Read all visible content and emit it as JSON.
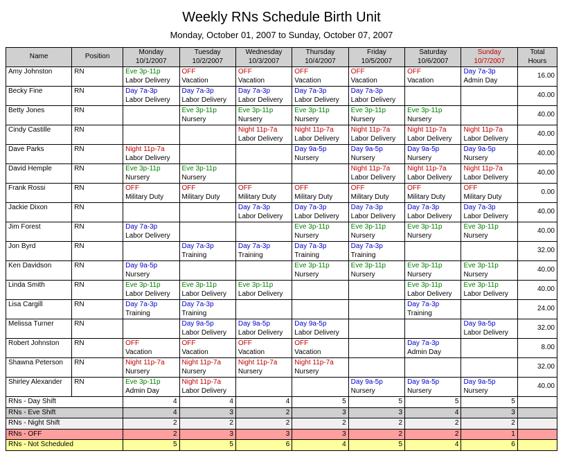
{
  "title": "Weekly RNs Schedule Birth Unit",
  "subtitle": "Monday, October 01, 2007 to Sunday, October 07, 2007",
  "headers": {
    "name": "Name",
    "position": "Position",
    "days": [
      {
        "label": "Monday",
        "date": "10/1/2007"
      },
      {
        "label": "Tuesday",
        "date": "10/2/2007"
      },
      {
        "label": "Wednesday",
        "date": "10/3/2007"
      },
      {
        "label": "Thursday",
        "date": "10/4/2007"
      },
      {
        "label": "Friday",
        "date": "10/5/2007"
      },
      {
        "label": "Saturday",
        "date": "10/6/2007"
      },
      {
        "label": "Sunday",
        "date": "10/7/2007"
      }
    ],
    "total": "Total Hours"
  },
  "rows": [
    {
      "name": "Amy Johnston",
      "pos": "RN",
      "cells": [
        {
          "l1": "Eve 3p-11p",
          "c1": "shift-eve",
          "l2": "Labor Delivery"
        },
        {
          "l1": "OFF",
          "c1": "off",
          "l2": "Vacation"
        },
        {
          "l1": "OFF",
          "c1": "off",
          "l2": "Vacation"
        },
        {
          "l1": "OFF",
          "c1": "off",
          "l2": "Vacation"
        },
        {
          "l1": "OFF",
          "c1": "off",
          "l2": "Vacation"
        },
        {
          "l1": "OFF",
          "c1": "off",
          "l2": "Vacation"
        },
        {
          "l1": "Day 7a-3p",
          "c1": "shift-day",
          "l2": "Admin Day"
        }
      ],
      "total": "16.00"
    },
    {
      "name": "Becky Fine",
      "pos": "RN",
      "cells": [
        {
          "l1": "Day 7a-3p",
          "c1": "shift-day",
          "l2": "Labor Delivery"
        },
        {
          "l1": "Day 7a-3p",
          "c1": "shift-day",
          "l2": "Labor Delivery"
        },
        {
          "l1": "Day 7a-3p",
          "c1": "shift-day",
          "l2": "Labor Delivery"
        },
        {
          "l1": "Day 7a-3p",
          "c1": "shift-day",
          "l2": "Labor Delivery"
        },
        {
          "l1": "Day 7a-3p",
          "c1": "shift-day",
          "l2": "Labor Delivery"
        },
        {},
        {}
      ],
      "total": "40.00"
    },
    {
      "name": "Betty Jones",
      "pos": "RN",
      "cells": [
        {},
        {
          "l1": "Eve 3p-11p",
          "c1": "shift-eve",
          "l2": "Nursery"
        },
        {
          "l1": "Eve 3p-11p",
          "c1": "shift-eve",
          "l2": "Nursery"
        },
        {
          "l1": "Eve 3p-11p",
          "c1": "shift-eve",
          "l2": "Nursery"
        },
        {
          "l1": "Eve 3p-11p",
          "c1": "shift-eve",
          "l2": "Nursery"
        },
        {
          "l1": "Eve 3p-11p",
          "c1": "shift-eve",
          "l2": "Nursery"
        },
        {}
      ],
      "total": "40.00"
    },
    {
      "name": "Cindy Castille",
      "pos": "RN",
      "cells": [
        {},
        {},
        {
          "l1": "Night 11p-7a",
          "c1": "shift-night",
          "l2": "Labor Delivery"
        },
        {
          "l1": "Night 11p-7a",
          "c1": "shift-night",
          "l2": "Labor Delivery"
        },
        {
          "l1": "Night 11p-7a",
          "c1": "shift-night",
          "l2": "Labor Delivery"
        },
        {
          "l1": "Night 11p-7a",
          "c1": "shift-night",
          "l2": "Labor Delivery"
        },
        {
          "l1": "Night 11p-7a",
          "c1": "shift-night",
          "l2": "Labor Delivery"
        }
      ],
      "total": "40.00"
    },
    {
      "name": "Dave Parks",
      "pos": "RN",
      "cells": [
        {
          "l1": "Night 11p-7a",
          "c1": "shift-night",
          "l2": "Labor Delivery"
        },
        {},
        {},
        {
          "l1": "Day 9a-5p",
          "c1": "shift-day",
          "l2": "Nursery"
        },
        {
          "l1": "Day 9a-5p",
          "c1": "shift-day",
          "l2": "Nursery"
        },
        {
          "l1": "Day 9a-5p",
          "c1": "shift-day",
          "l2": "Nursery"
        },
        {
          "l1": "Day 9a-5p",
          "c1": "shift-day",
          "l2": "Nursery"
        }
      ],
      "total": "40.00"
    },
    {
      "name": "David Hemple",
      "pos": "RN",
      "cells": [
        {
          "l1": "Eve 3p-11p",
          "c1": "shift-eve",
          "l2": "Nursery"
        },
        {
          "l1": "Eve 3p-11p",
          "c1": "shift-eve",
          "l2": "Nursery"
        },
        {},
        {},
        {
          "l1": "Night 11p-7a",
          "c1": "shift-night",
          "l2": "Labor Delivery"
        },
        {
          "l1": "Night 11p-7a",
          "c1": "shift-night",
          "l2": "Labor Delivery"
        },
        {
          "l1": "Night 11p-7a",
          "c1": "shift-night",
          "l2": "Labor Delivery"
        }
      ],
      "total": "40.00"
    },
    {
      "name": "Frank Rossi",
      "pos": "RN",
      "cells": [
        {
          "l1": "OFF",
          "c1": "off",
          "l2": "Military Duty"
        },
        {
          "l1": "OFF",
          "c1": "off",
          "l2": "Military Duty"
        },
        {
          "l1": "OFF",
          "c1": "off",
          "l2": "Military Duty"
        },
        {
          "l1": "OFF",
          "c1": "off",
          "l2": "Military Duty"
        },
        {
          "l1": "OFF",
          "c1": "off",
          "l2": "Military Duty"
        },
        {
          "l1": "OFF",
          "c1": "off",
          "l2": "Military Duty"
        },
        {
          "l1": "OFF",
          "c1": "off",
          "l2": "Military Duty"
        }
      ],
      "total": "0.00"
    },
    {
      "name": "Jackie Dixon",
      "pos": "RN",
      "cells": [
        {},
        {},
        {
          "l1": "Day 7a-3p",
          "c1": "shift-day",
          "l2": "Labor Delivery"
        },
        {
          "l1": "Day 7a-3p",
          "c1": "shift-day",
          "l2": "Labor Delivery"
        },
        {
          "l1": "Day 7a-3p",
          "c1": "shift-day",
          "l2": "Labor Delivery"
        },
        {
          "l1": "Day 7a-3p",
          "c1": "shift-day",
          "l2": "Labor Delivery"
        },
        {
          "l1": "Day 7a-3p",
          "c1": "shift-day",
          "l2": "Labor Delivery"
        }
      ],
      "total": "40.00"
    },
    {
      "name": "Jim Forest",
      "pos": "RN",
      "cells": [
        {
          "l1": "Day 7a-3p",
          "c1": "shift-day",
          "l2": "Labor Delivery"
        },
        {},
        {},
        {
          "l1": "Eve 3p-11p",
          "c1": "shift-eve",
          "l2": "Nursery"
        },
        {
          "l1": "Eve 3p-11p",
          "c1": "shift-eve",
          "l2": "Nursery"
        },
        {
          "l1": "Eve 3p-11p",
          "c1": "shift-eve",
          "l2": "Nursery"
        },
        {
          "l1": "Eve 3p-11p",
          "c1": "shift-eve",
          "l2": "Nursery"
        }
      ],
      "total": "40.00"
    },
    {
      "name": "Jon Byrd",
      "pos": "RN",
      "cells": [
        {},
        {
          "l1": "Day 7a-3p",
          "c1": "shift-day",
          "l2": "Training"
        },
        {
          "l1": "Day 7a-3p",
          "c1": "shift-day",
          "l2": "Training"
        },
        {
          "l1": "Day 7a-3p",
          "c1": "shift-day",
          "l2": "Training"
        },
        {
          "l1": "Day 7a-3p",
          "c1": "shift-day",
          "l2": "Training"
        },
        {},
        {}
      ],
      "total": "32.00"
    },
    {
      "name": "Ken Davidson",
      "pos": "RN",
      "cells": [
        {
          "l1": "Day 9a-5p",
          "c1": "shift-day",
          "l2": "Nursery"
        },
        {},
        {},
        {
          "l1": "Eve 3p-11p",
          "c1": "shift-eve",
          "l2": "Nursery"
        },
        {
          "l1": "Eve 3p-11p",
          "c1": "shift-eve",
          "l2": "Nursery"
        },
        {
          "l1": "Eve 3p-11p",
          "c1": "shift-eve",
          "l2": "Nursery"
        },
        {
          "l1": "Eve 3p-11p",
          "c1": "shift-eve",
          "l2": "Nursery"
        }
      ],
      "total": "40.00"
    },
    {
      "name": "Linda Smith",
      "pos": "RN",
      "cells": [
        {
          "l1": "Eve 3p-11p",
          "c1": "shift-eve",
          "l2": "Labor Delivery"
        },
        {
          "l1": "Eve 3p-11p",
          "c1": "shift-eve",
          "l2": "Labor Delivery"
        },
        {
          "l1": "Eve 3p-11p",
          "c1": "shift-eve",
          "l2": "Labor Delivery"
        },
        {},
        {},
        {
          "l1": "Eve 3p-11p",
          "c1": "shift-eve",
          "l2": "Labor Delivery"
        },
        {
          "l1": "Eve 3p-11p",
          "c1": "shift-eve",
          "l2": "Labor Delivery"
        }
      ],
      "total": "40.00"
    },
    {
      "name": "Lisa Cargill",
      "pos": "RN",
      "cells": [
        {
          "l1": "Day 7a-3p",
          "c1": "shift-day",
          "l2": "Training"
        },
        {
          "l1": "Day 7a-3p",
          "c1": "shift-day",
          "l2": "Training"
        },
        {},
        {},
        {},
        {
          "l1": "Day 7a-3p",
          "c1": "shift-day",
          "l2": "Training"
        },
        {}
      ],
      "total": "24.00"
    },
    {
      "name": "Melissa Turner",
      "pos": "RN",
      "cells": [
        {},
        {
          "l1": "Day 9a-5p",
          "c1": "shift-day",
          "l2": "Labor Delivery"
        },
        {
          "l1": "Day 9a-5p",
          "c1": "shift-day",
          "l2": "Labor Delivery"
        },
        {
          "l1": "Day 9a-5p",
          "c1": "shift-day",
          "l2": "Labor Delivery"
        },
        {},
        {},
        {
          "l1": "Day 9a-5p",
          "c1": "shift-day",
          "l2": "Labor Delivery"
        }
      ],
      "total": "32.00"
    },
    {
      "name": "Robert Johnston",
      "pos": "RN",
      "cells": [
        {
          "l1": "OFF",
          "c1": "off",
          "l2": "Vacation"
        },
        {
          "l1": "OFF",
          "c1": "off",
          "l2": "Vacation"
        },
        {
          "l1": "OFF",
          "c1": "off",
          "l2": "Vacation"
        },
        {
          "l1": "OFF",
          "c1": "off",
          "l2": "Vacation"
        },
        {},
        {
          "l1": "Day 7a-3p",
          "c1": "shift-day",
          "l2": "Admin Day"
        },
        {}
      ],
      "total": "8.00"
    },
    {
      "name": "Shawna Peterson",
      "pos": "RN",
      "cells": [
        {
          "l1": "Night 11p-7a",
          "c1": "shift-night",
          "l2": "Nursery"
        },
        {
          "l1": "Night 11p-7a",
          "c1": "shift-night",
          "l2": "Nursery"
        },
        {
          "l1": "Night 11p-7a",
          "c1": "shift-night",
          "l2": "Nursery"
        },
        {
          "l1": "Night 11p-7a",
          "c1": "shift-night",
          "l2": "Nursery"
        },
        {},
        {},
        {}
      ],
      "total": "32.00"
    },
    {
      "name": "Shirley Alexander",
      "pos": "RN",
      "cells": [
        {
          "l1": "Eve 3p-11p",
          "c1": "shift-eve",
          "l2": "Admin Day"
        },
        {
          "l1": "Night 11p-7a",
          "c1": "shift-night",
          "l2": "Labor Delivery"
        },
        {},
        {},
        {
          "l1": "Day 9a-5p",
          "c1": "shift-day",
          "l2": "Nursery"
        },
        {
          "l1": "Day 9a-5p",
          "c1": "shift-day",
          "l2": "Nursery"
        },
        {
          "l1": "Day 9a-5p",
          "c1": "shift-day",
          "l2": "Nursery"
        }
      ],
      "total": "40.00"
    }
  ],
  "summary": [
    {
      "label": "RNs - Day Shift",
      "vals": [
        "4",
        "4",
        "4",
        "5",
        "5",
        "5",
        "5"
      ],
      "class": "summary-day"
    },
    {
      "label": "RNs - Eve Shift",
      "vals": [
        "4",
        "3",
        "2",
        "3",
        "3",
        "4",
        "3"
      ],
      "class": "summary-eve"
    },
    {
      "label": "RNs - Night Shift",
      "vals": [
        "2",
        "2",
        "2",
        "2",
        "2",
        "2",
        "2"
      ],
      "class": "summary-night"
    },
    {
      "label": "RNs - OFF",
      "vals": [
        "2",
        "3",
        "3",
        "3",
        "2",
        "2",
        "1"
      ],
      "class": "summary-off"
    },
    {
      "label": "RNs - Not Scheduled",
      "vals": [
        "5",
        "5",
        "6",
        "4",
        "5",
        "4",
        "6"
      ],
      "class": "summary-not"
    }
  ]
}
